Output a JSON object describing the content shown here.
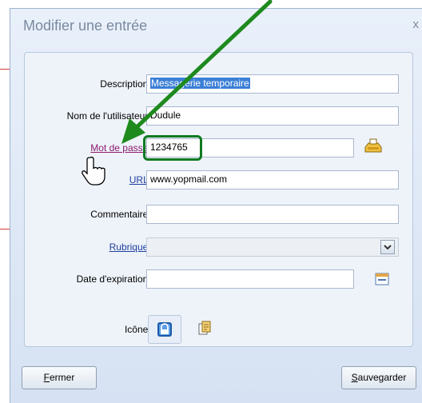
{
  "dialog": {
    "title": "Modifier une entrée",
    "close_glyph": "x"
  },
  "form": {
    "description": {
      "label": "Description :",
      "value": "Messagerie temporaire"
    },
    "username": {
      "label": "Nom de l'utilisateur :",
      "value": "Dudule"
    },
    "password": {
      "label": "Mot de passe :",
      "value": "1234765"
    },
    "url": {
      "label": "URL :",
      "value": "www.yopmail.com"
    },
    "comment": {
      "label": "Commentaire :",
      "value": ""
    },
    "category": {
      "label": "Rubrique :",
      "value": ""
    },
    "expiry": {
      "label": "Date d'expiration :",
      "value": ""
    },
    "icon": {
      "label": "Icône :"
    }
  },
  "buttons": {
    "close_mnemonic": "F",
    "close_rest": "ermer",
    "save_mnemonic": "S",
    "save_rest": "auvegarder"
  },
  "annotations": {
    "arrow_color": "#1e8a1e",
    "highlight_color": "#0f7a20",
    "frame_color": "#d23a3a"
  },
  "icons": [
    "close-icon",
    "generate-password-icon",
    "hand-cursor-icon",
    "dropdown-arrow-icon",
    "calendar-icon",
    "lock-icon",
    "change-icon-icon",
    "annotation-arrow-icon"
  ]
}
